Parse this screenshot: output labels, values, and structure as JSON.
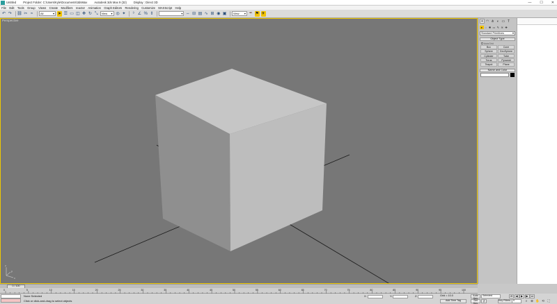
{
  "titlebar": {
    "doc": "Untitled",
    "project": "Project Folder: C:\\Users\\Kyle\\Documents\\3dsMax",
    "app": "Autodesk 3ds Max 9 (32)",
    "display": "Display : Direct 3D",
    "minimize": "—",
    "maximize": "☐",
    "close": "✕"
  },
  "menu": [
    "File",
    "Edit",
    "Tools",
    "Group",
    "Views",
    "Create",
    "Modifiers",
    "reactor",
    "Animation",
    "Graph Editors",
    "Rendering",
    "Customize",
    "MAXScript",
    "Help"
  ],
  "toolbar": {
    "selection_filter": "All",
    "ref_coord": "View",
    "named_sel": "",
    "snap_dd": "View"
  },
  "viewport": {
    "label": "Perspective",
    "background": "#777777",
    "border_color": "#f0c800",
    "axis_x": "x",
    "axis_y": "y",
    "axis_z": "z"
  },
  "command_panel": {
    "category": "Standard Primitives",
    "rollout_object_type": "Object Type",
    "autogrid": "AutoGrid",
    "objects": [
      "Box",
      "Cone",
      "Sphere",
      "GeoSphere",
      "Cylinder",
      "Tube",
      "Torus",
      "Pyramid",
      "Teapot",
      "Plane"
    ],
    "rollout_name_color": "Name and Color",
    "object_color": "#000000"
  },
  "time": {
    "slider": "0 / 100",
    "ticks": [
      "0",
      "5",
      "10",
      "15",
      "20",
      "25",
      "30",
      "35",
      "40",
      "45",
      "50",
      "55",
      "60",
      "65",
      "70",
      "75",
      "80",
      "85",
      "90",
      "95",
      "100"
    ]
  },
  "status": {
    "selection": "None Selected",
    "prompt": "Click or click-and-drag to select objects",
    "x_label": "X:",
    "y_label": "Y:",
    "z_label": "Z:",
    "grid": "Grid = 10.0",
    "add_time_tag": "Add Time Tag",
    "auto_key": "Auto Key",
    "auto_key_mode": "Selected",
    "set_key": "Set Key",
    "key_filters": "Key Filters...",
    "frame": "0",
    "accent": "#f2c300"
  }
}
